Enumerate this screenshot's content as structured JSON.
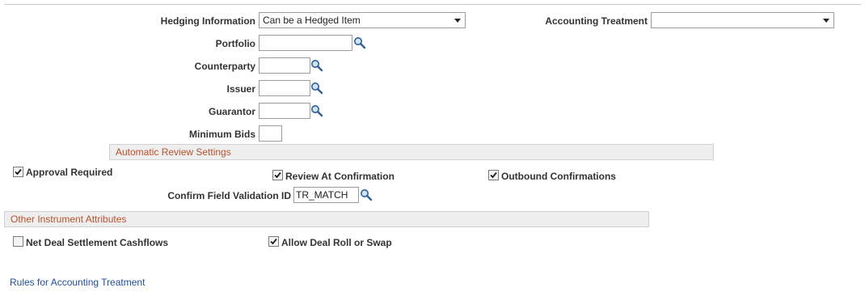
{
  "hedging": {
    "label": "Hedging Information",
    "value": "Can be a Hedged Item"
  },
  "accounting": {
    "label": "Accounting Treatment",
    "value": ""
  },
  "portfolio": {
    "label": "Portfolio",
    "value": ""
  },
  "counterparty": {
    "label": "Counterparty",
    "value": ""
  },
  "issuer": {
    "label": "Issuer",
    "value": ""
  },
  "guarantor": {
    "label": "Guarantor",
    "value": ""
  },
  "minimum_bids": {
    "label": "Minimum Bids",
    "value": ""
  },
  "auto_review": {
    "title": "Automatic Review Settings",
    "approval_required": {
      "label": "Approval Required",
      "checked": true
    },
    "review_at_confirmation": {
      "label": "Review At Confirmation",
      "checked": true
    },
    "outbound_confirmations": {
      "label": "Outbound Confirmations",
      "checked": true
    },
    "confirm_field_validation": {
      "label": "Confirm Field Validation ID",
      "value": "TR_MATCH"
    }
  },
  "other_attributes": {
    "title": "Other Instrument Attributes",
    "net_deal_settlement": {
      "label": "Net Deal Settlement Cashflows",
      "checked": false
    },
    "allow_deal_roll": {
      "label": "Allow Deal Roll or Swap",
      "checked": true
    }
  },
  "rules_link": "Rules for Accounting Treatment",
  "icons": {
    "lookup": "magnifier-icon",
    "dropdown": "chevron-down-icon",
    "check": "checkmark-icon"
  },
  "colors": {
    "section_title": "#b8512c",
    "link": "#1f4e99",
    "section_bg": "#eeeeee"
  }
}
